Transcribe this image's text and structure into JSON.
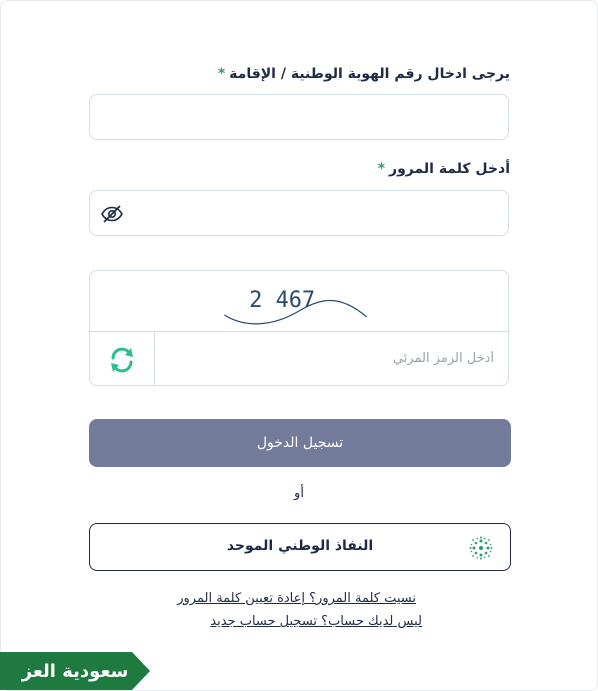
{
  "form": {
    "id_label": "يرجى ادخال رقم الهوية الوطنية / الإقامة",
    "required_mark": "*",
    "id_value": "",
    "password_label": "أدخل كلمة المرور",
    "password_value": "",
    "captcha_text": "2 467",
    "captcha_placeholder": "أدخل الرمز المرئي",
    "login_button": "تسجيل الدخول",
    "or_text": "أو",
    "nafath_button": "النفاذ الوطني الموحد"
  },
  "links": {
    "forgot_password": "نسيت كلمة المرور؟ إعادة تعيين كلمة المرور",
    "register": "ليس لديك حساب؟ تسجيل حساب جديد"
  },
  "brand": {
    "logo_text": "سعودية العز"
  },
  "colors": {
    "primary_button": "#737b9b",
    "accent_green": "#2e9b6f",
    "text_dark": "#1f2a44",
    "border": "#d5dde5",
    "brand_green": "#1e7a3f"
  },
  "icons": {
    "password_toggle": "eye-off-icon",
    "captcha_refresh": "refresh-icon",
    "nafath": "nafath-logo-icon"
  }
}
